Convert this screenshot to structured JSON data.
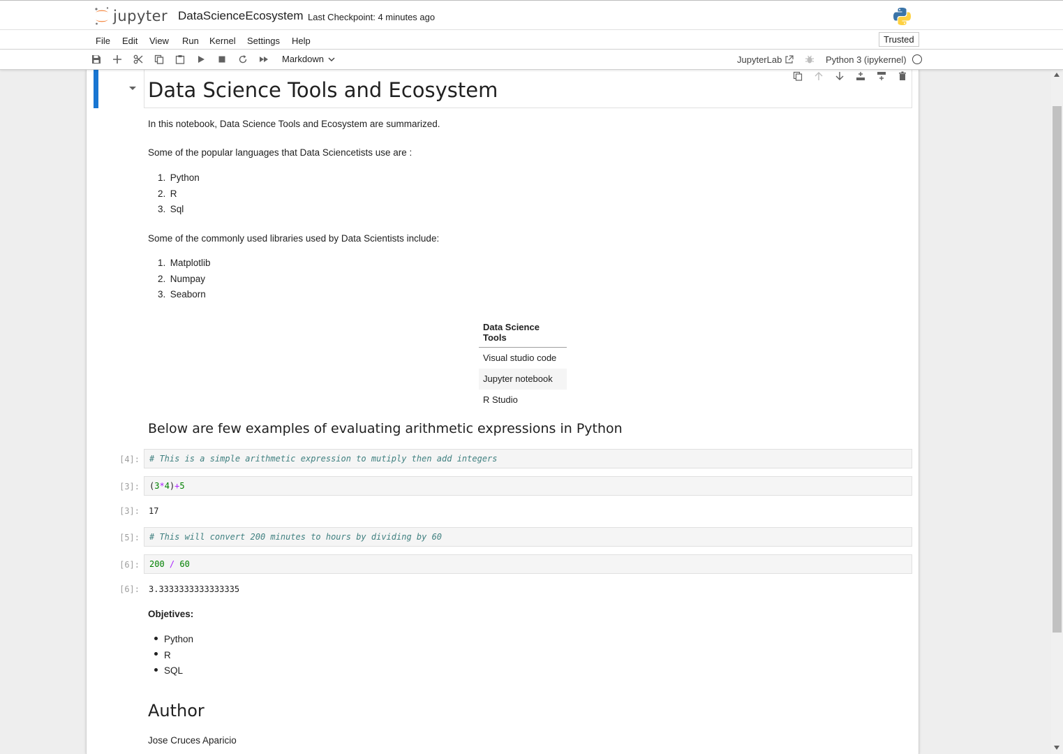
{
  "header": {
    "logo_text": "jupyter",
    "notebook_name": "DataScienceEcosystem",
    "checkpoint": "Last Checkpoint: 4 minutes ago"
  },
  "menu": {
    "items": [
      "File",
      "Edit",
      "View",
      "Run",
      "Kernel",
      "Settings",
      "Help"
    ],
    "trusted": "Trusted"
  },
  "toolbar": {
    "cell_type": "Markdown",
    "jupyterlab_link": "JupyterLab",
    "kernel": "Python 3 (ipykernel)"
  },
  "cells": {
    "title": "Data Science Tools and Ecosystem",
    "intro": "In this notebook, Data Science Tools and Ecosystem are summarized.",
    "languages_heading": "Some of the popular languages that Data Sciencetists use are :",
    "languages": [
      "Python",
      "R",
      "Sql"
    ],
    "libraries_heading": "Some of the commonly used libraries used by Data Scientists include:",
    "libraries": [
      "Matplotlib",
      "Numpay",
      "Seaborn"
    ],
    "table": {
      "header": "Data Science Tools",
      "rows": [
        "Visual studio code",
        "Jupyter notebook",
        "R Studio"
      ]
    },
    "arithmetic_heading": "Below are few examples of evaluating arithmetic expressions in Python",
    "code_cells": [
      {
        "prompt": "[4]:",
        "comment": "# This is a simple arithmetic expression to mutiply then add integers"
      },
      {
        "prompt": "[3]:",
        "code_parts": [
          "(",
          "3",
          "*",
          "4",
          ")",
          "+",
          "5"
        ],
        "output_prompt": "[3]:",
        "output": "17"
      },
      {
        "prompt": "[5]:",
        "comment": "# This will convert 200 minutes to hours by dividing by 60"
      },
      {
        "prompt": "[6]:",
        "code_parts": [
          "200",
          " / ",
          "60"
        ],
        "output_prompt": "[6]:",
        "output": "3.3333333333333335"
      }
    ],
    "objectives_heading": "Objetives:",
    "objectives": [
      "Python",
      "R",
      "SQL"
    ],
    "author_heading": "Author",
    "author_name": "Jose Cruces Aparicio"
  },
  "colors": {
    "accent": "#1976d2",
    "comment": "#408080",
    "number": "#008000",
    "operator": "#aa22ff",
    "jupyter_orange": "#f37726"
  }
}
